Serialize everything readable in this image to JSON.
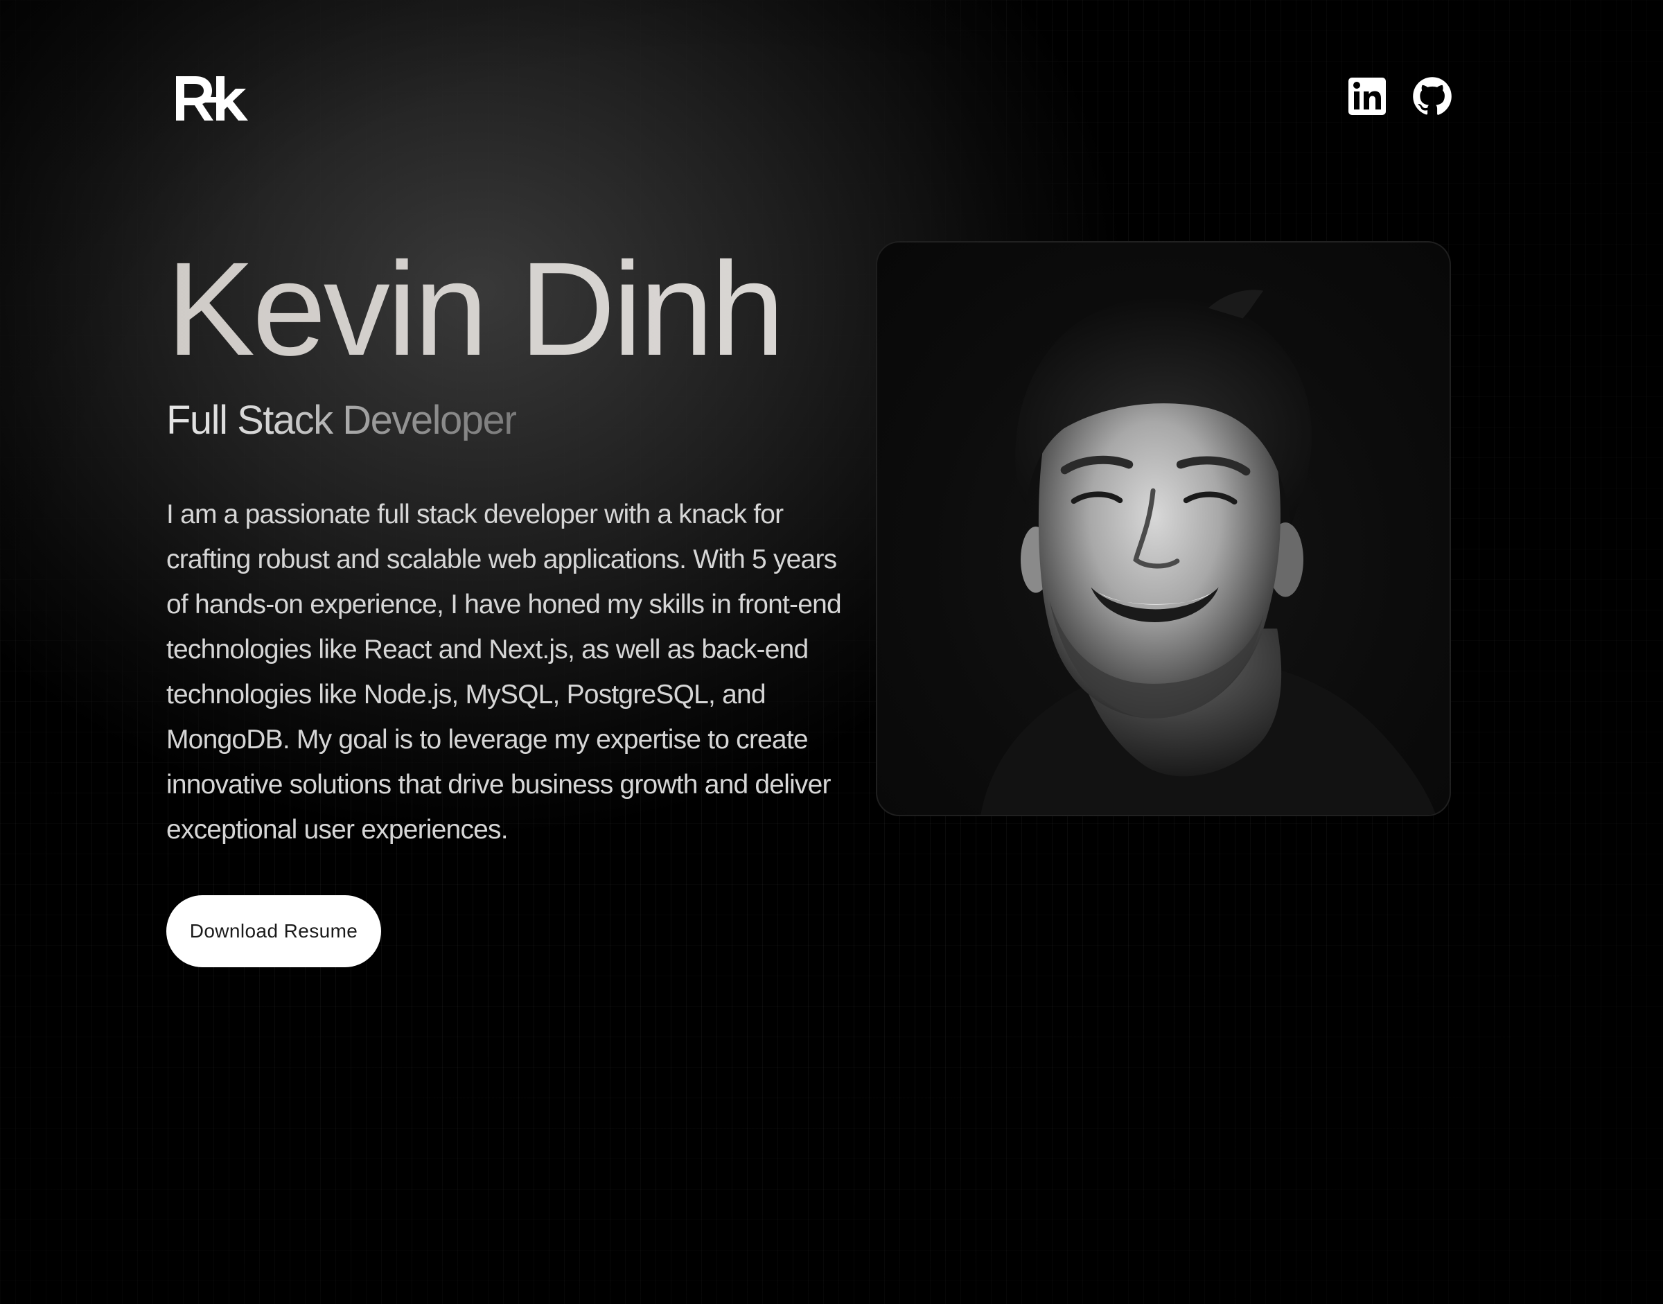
{
  "header": {
    "logo_text": "Rk",
    "social": [
      {
        "icon": "linkedin-icon",
        "label": "LinkedIn"
      },
      {
        "icon": "github-icon",
        "label": "GitHub"
      }
    ]
  },
  "hero": {
    "name": "Kevin Dinh",
    "role": "Full Stack Developer",
    "bio": "I am a passionate full stack developer with a knack for crafting robust and scalable web applications. With 5 years of hands-on experience, I have honed my skills in front-end technologies like React and Next.js, as well as back-end technologies like Node.js, MySQL, PostgreSQL, and MongoDB. My goal is to leverage my expertise to create innovative solutions that drive business growth and deliver exceptional user experiences.",
    "resume_button": "Download Resume"
  },
  "photo": {
    "description_icon": "profile-photo"
  },
  "colors": {
    "background": "#000000",
    "text": "#d6d6d6",
    "button_bg": "#ffffff",
    "button_text": "#1a1a1a"
  }
}
